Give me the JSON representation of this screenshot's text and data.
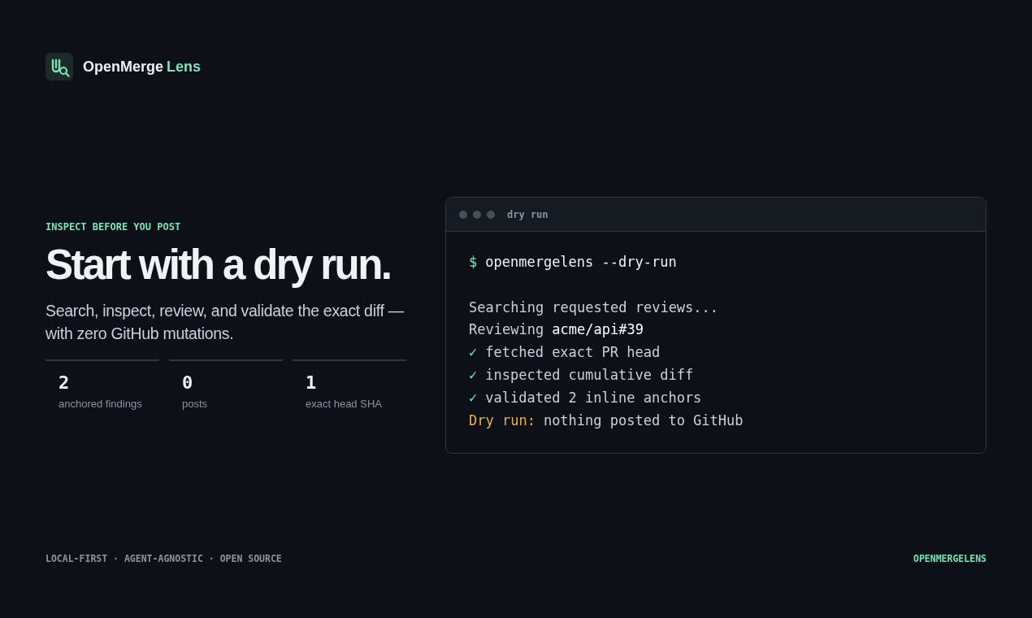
{
  "brand": {
    "name": "OpenMerge",
    "accent": "Lens"
  },
  "hero": {
    "eyebrow": "INSPECT BEFORE YOU POST",
    "title": "Start with a dry run.",
    "subtitle": "Search, inspect, review, and validate the exact diff —with zero GitHub mutations.",
    "stats": [
      {
        "value": "2",
        "label": "anchored findings"
      },
      {
        "value": "0",
        "label": "posts"
      },
      {
        "value": "1",
        "label": "exact head SHA"
      }
    ]
  },
  "terminal": {
    "title": "dry run",
    "lines": [
      {
        "kind": "command",
        "prompt": "$",
        "text": "openmergelens --dry-run"
      },
      {
        "kind": "blank"
      },
      {
        "kind": "plain",
        "text": "Searching requested reviews..."
      },
      {
        "kind": "plain",
        "text": "Reviewing **acme/api#39**"
      },
      {
        "kind": "check",
        "mark": "✓",
        "text": "fetched exact PR head"
      },
      {
        "kind": "check",
        "mark": "✓",
        "text": "inspected cumulative diff"
      },
      {
        "kind": "check",
        "mark": "✓",
        "text": "validated 2 inline anchors"
      },
      {
        "kind": "notice",
        "label": "Dry run:",
        "text": "nothing posted to GitHub"
      }
    ]
  },
  "footer": {
    "tagline": "LOCAL-FIRST · AGENT-AGNOSTIC · OPEN SOURCE",
    "wordmark": "OPENMERGELENS"
  }
}
